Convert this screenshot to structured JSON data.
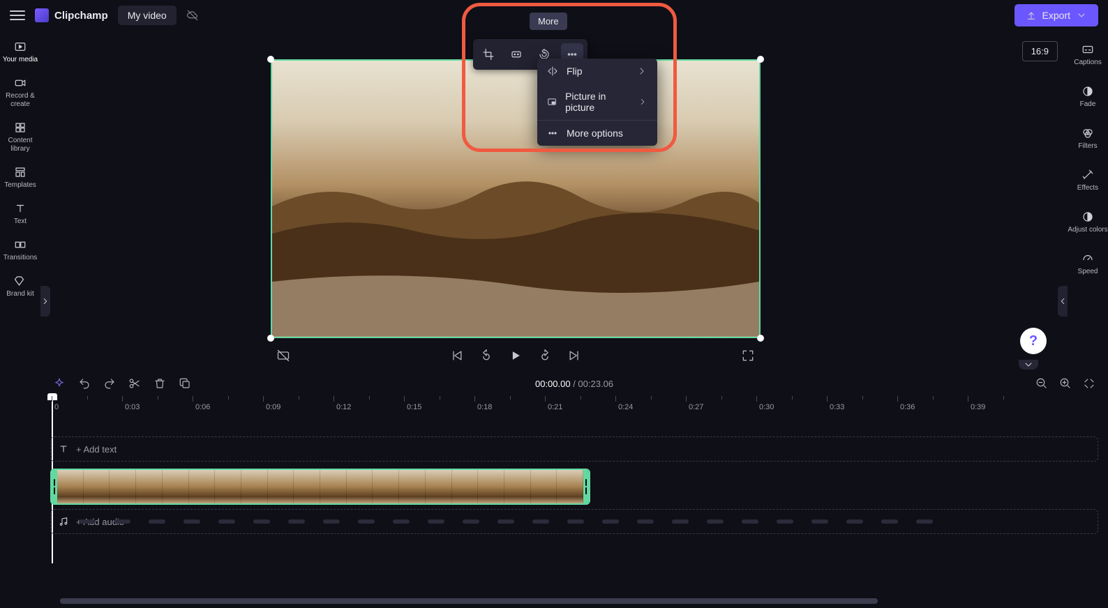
{
  "app": {
    "name": "Clipchamp",
    "title": "My video"
  },
  "topbar": {
    "export": "Export",
    "aspect": "16:9"
  },
  "float_tooltip": "More",
  "dropdown": {
    "flip": "Flip",
    "pip": "Picture in picture",
    "more": "More options"
  },
  "left_rail": [
    {
      "label": "Your media"
    },
    {
      "label": "Record & create"
    },
    {
      "label": "Content library"
    },
    {
      "label": "Templates"
    },
    {
      "label": "Text"
    },
    {
      "label": "Transitions"
    },
    {
      "label": "Brand kit"
    }
  ],
  "right_rail": [
    {
      "label": "Captions"
    },
    {
      "label": "Fade"
    },
    {
      "label": "Filters"
    },
    {
      "label": "Effects"
    },
    {
      "label": "Adjust colors"
    },
    {
      "label": "Speed"
    }
  ],
  "time": {
    "current": "00:00.00",
    "total": "00:23.06"
  },
  "ruler": [
    "0",
    "0:03",
    "0:06",
    "0:09",
    "0:12",
    "0:15",
    "0:18",
    "0:21",
    "0:24",
    "0:27",
    "0:30",
    "0:33",
    "0:36",
    "0:39"
  ],
  "tracks": {
    "add_text": "+ Add text",
    "add_audio": "+ Add audio"
  }
}
